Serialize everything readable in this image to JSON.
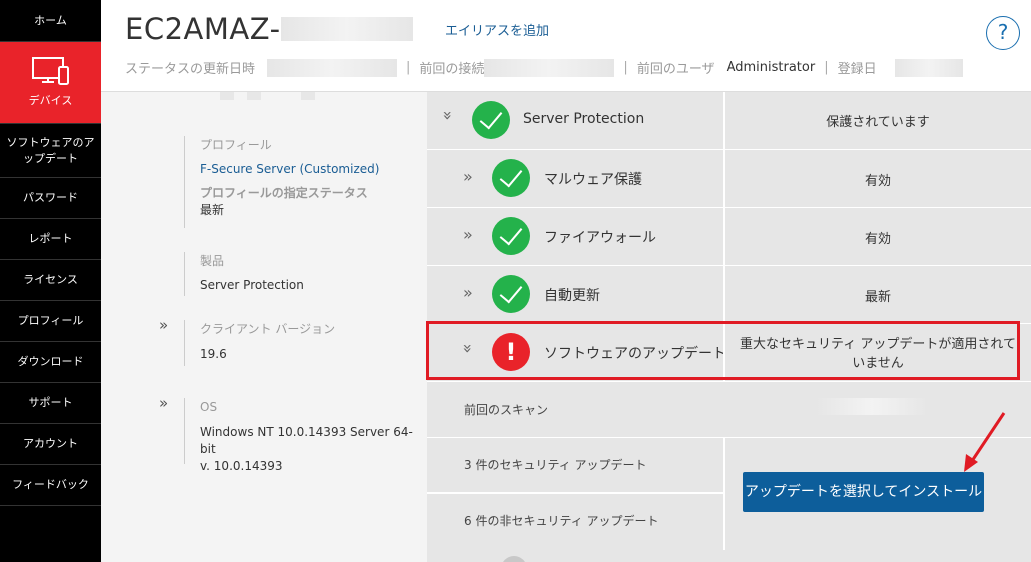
{
  "sidebar": {
    "items": [
      {
        "label": "ホーム"
      },
      {
        "label": "デバイス"
      },
      {
        "label": "ソフトウェアのアップデート"
      },
      {
        "label": "パスワード"
      },
      {
        "label": "レポート"
      },
      {
        "label": "ライセンス"
      },
      {
        "label": "プロフィール"
      },
      {
        "label": "ダウンロード"
      },
      {
        "label": "サポート"
      },
      {
        "label": "アカウント"
      },
      {
        "label": "フィードバック"
      }
    ],
    "active_icon": "device-icon",
    "active_color": "#e9232a"
  },
  "header": {
    "title": "EC2AMAZ-",
    "alias_link": "エイリアスを追加",
    "help": "?",
    "meta": {
      "status_updated": "ステータスの更新日時",
      "last_connection": "前回の接続",
      "last_user_label": "前回のユーザ",
      "last_user_value": "Administrator",
      "registered": "登録日"
    }
  },
  "info": {
    "profile_label": "プロフィール",
    "profile_value": "F-Secure Server (Customized)",
    "profile_status_label": "プロフィールの指定ステータス",
    "profile_status_value": "最新",
    "product_label": "製品",
    "product_value": "Server Protection",
    "client_version_label": "クライアント バージョン",
    "client_version_value": "19.6",
    "os_label": "OS",
    "os_value_1": "Windows NT 10.0.14393 Server 64-bit",
    "os_value_2": "v. 10.0.14393"
  },
  "panel": {
    "rows": [
      {
        "name": "Server Protection",
        "value": "保護されています",
        "status": "ok"
      },
      {
        "name": "マルウェア保護",
        "value": "有効",
        "status": "ok"
      },
      {
        "name": "ファイアウォール",
        "value": "有効",
        "status": "ok"
      },
      {
        "name": "自動更新",
        "value": "最新",
        "status": "ok"
      },
      {
        "name": "ソフトウェアのアップデート",
        "value_1": "重大なセキュリティ アップデートが適用されて",
        "value_2": "いません",
        "status": "error"
      }
    ],
    "last_scan_label": "前回のスキャン",
    "security_updates": "3 件のセキュリティ アップデート",
    "non_security_updates": "6 件の非セキュリティ アップデート",
    "install_button": "アップデートを選択してインストール"
  },
  "colors": {
    "accent": "#e9232a",
    "ok": "#24b24b",
    "link": "#1a5d94",
    "button": "#0d5e9b"
  }
}
